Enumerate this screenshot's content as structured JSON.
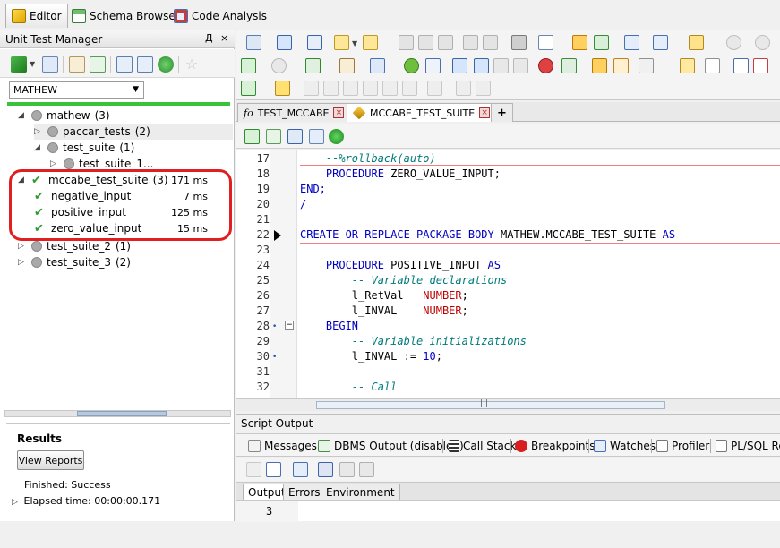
{
  "top_tabs": [
    {
      "label": "Editor",
      "active": true,
      "icon": "editor-icon"
    },
    {
      "label": "Schema Browser",
      "active": false,
      "icon": "schema-browser-icon"
    },
    {
      "label": "Code Analysis",
      "active": false,
      "icon": "code-analysis-icon"
    }
  ],
  "unit_test_manager": {
    "title": "Unit Test Manager",
    "pin_label": "Д",
    "close_label": "×",
    "schema": "MATHEW",
    "tree": [
      {
        "label": "mathew",
        "count": "(3)",
        "status": "pending"
      },
      {
        "label": "paccar_tests",
        "count": "(2)",
        "status": "pending"
      },
      {
        "label": "test_suite",
        "count": "(1)",
        "status": "pending"
      },
      {
        "label": "test_suite_1...",
        "count": "",
        "status": "pending"
      },
      {
        "label": "mccabe_test_suite",
        "count": "(3)",
        "status": "passed",
        "time": "171 ms"
      },
      {
        "label": "negative_input",
        "count": "",
        "status": "passed",
        "time": "7 ms"
      },
      {
        "label": "positive_input",
        "count": "",
        "status": "passed",
        "time": "125 ms"
      },
      {
        "label": "zero_value_input",
        "count": "",
        "status": "passed",
        "time": "15 ms"
      },
      {
        "label": "test_suite_2",
        "count": "(1)",
        "status": "pending"
      },
      {
        "label": "test_suite_3",
        "count": "(2)",
        "status": "pending"
      }
    ]
  },
  "results": {
    "title": "Results",
    "view_reports": "View Reports",
    "finished": "Finished: Success",
    "elapsed": "Elapsed time: 00:00:00.171"
  },
  "editor_tabs": [
    {
      "label": "TEST_MCCABE",
      "prefix": "fο",
      "active": false
    },
    {
      "label": "MCCABE_TEST_SUITE",
      "prefix": "",
      "active": true
    },
    {
      "label": "+",
      "prefix": "",
      "active": false
    }
  ],
  "code": {
    "lines": [
      {
        "n": "17",
        "text": "    --%rollback(auto)"
      },
      {
        "n": "18",
        "text": "    PROCEDURE ZERO_VALUE_INPUT;"
      },
      {
        "n": "19",
        "text": "END;"
      },
      {
        "n": "20",
        "text": "/"
      },
      {
        "n": "21",
        "text": ""
      },
      {
        "n": "22",
        "text": "CREATE OR REPLACE PACKAGE BODY MATHEW.MCCABE_TEST_SUITE AS"
      },
      {
        "n": "23",
        "text": ""
      },
      {
        "n": "24",
        "text": "    PROCEDURE POSITIVE_INPUT AS"
      },
      {
        "n": "25",
        "text": "        -- Variable declarations"
      },
      {
        "n": "26",
        "text": "        l_RetVal   NUMBER;"
      },
      {
        "n": "27",
        "text": "        l_INVAL    NUMBER;"
      },
      {
        "n": "28",
        "text": "    BEGIN"
      },
      {
        "n": "29",
        "text": "        -- Variable initializations"
      },
      {
        "n": "30",
        "text": "        l_INVAL := 10;"
      },
      {
        "n": "31",
        "text": ""
      },
      {
        "n": "32",
        "text": "        -- Call"
      }
    ]
  },
  "hscroll_grip": "|||",
  "script_output": {
    "title": "Script Output",
    "tabs": [
      {
        "label": "Messages",
        "icon": "messages-icon"
      },
      {
        "label": "DBMS Output (disabled)",
        "icon": "dbms-output-icon"
      },
      {
        "label": "Call Stack",
        "icon": "call-stack-icon"
      },
      {
        "label": "Breakpoints",
        "icon": "breakpoints-icon"
      },
      {
        "label": "Watches",
        "icon": "watches-icon"
      },
      {
        "label": "Profiler",
        "icon": "profiler-icon"
      },
      {
        "label": "PL/SQL Res",
        "icon": "plsql-results-icon"
      }
    ],
    "bottom_tabs": [
      {
        "label": "Output",
        "active": true
      },
      {
        "label": "Errors",
        "active": false
      },
      {
        "label": "Environment",
        "active": false
      }
    ],
    "output_line": "3"
  },
  "colors": {
    "accent_green": "#3ac23a",
    "highlight_red": "#e02020",
    "keyword_blue": "#0000c0",
    "comment_teal": "#007a7a",
    "type_red": "#c00000"
  }
}
